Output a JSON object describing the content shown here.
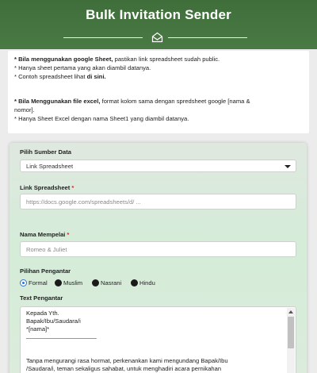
{
  "header": {
    "title": "Bulk Invitation Sender",
    "icon": "envelope-open-icon"
  },
  "info": {
    "line1_bold": "* Bila menggunakan google Sheet,",
    "line1_rest": " pastikan link spreadsheet sudah public.",
    "line2": "* Hanya sheet pertama yang akan diambil datanya.",
    "line3_pre": "* Contoh spreadsheet lihat ",
    "line3_link": "di sini.",
    "line4_bold": "* Bila Menggunakan file excel,",
    "line4_rest": " format kolom sama dengan spredsheet google [nama &",
    "line5": "nomor].",
    "line6": "* Hanya Sheet Excel dengan nama Sheet1 yang diambil datanya."
  },
  "form": {
    "source_label": "Pilih Sumber Data",
    "source_value": "Link Spreadsheet",
    "link_label": "Link Spreadsheet",
    "link_placeholder": "https://docs.google.com/spreadsheets/d/ ...",
    "name_label": "Nama Mempelai",
    "name_placeholder": "Romeo & Juliet",
    "required_mark": "*",
    "intro_label": "Pilihan Pengantar",
    "options": [
      "Formal",
      "Muslim",
      "Nasrani",
      "Hindu"
    ],
    "selected_option": "Formal",
    "text_label": "Text Pengantar",
    "text_lines": [
      "Kepada Yth.",
      "Bapak/Ibu/Saudara/i",
      "*[nama]*",
      "_____________________",
      "",
      "Tanpa mengurangi rasa hormat, perkenankan kami mengundang Bapak/Ibu",
      "/Saudara/i, teman sekaligus sahabat, untuk menghadiri acara pernikahan"
    ]
  },
  "colors": {
    "header": "#4a7a44",
    "accent_radio": "#2f74d0",
    "required": "#dd2222"
  }
}
